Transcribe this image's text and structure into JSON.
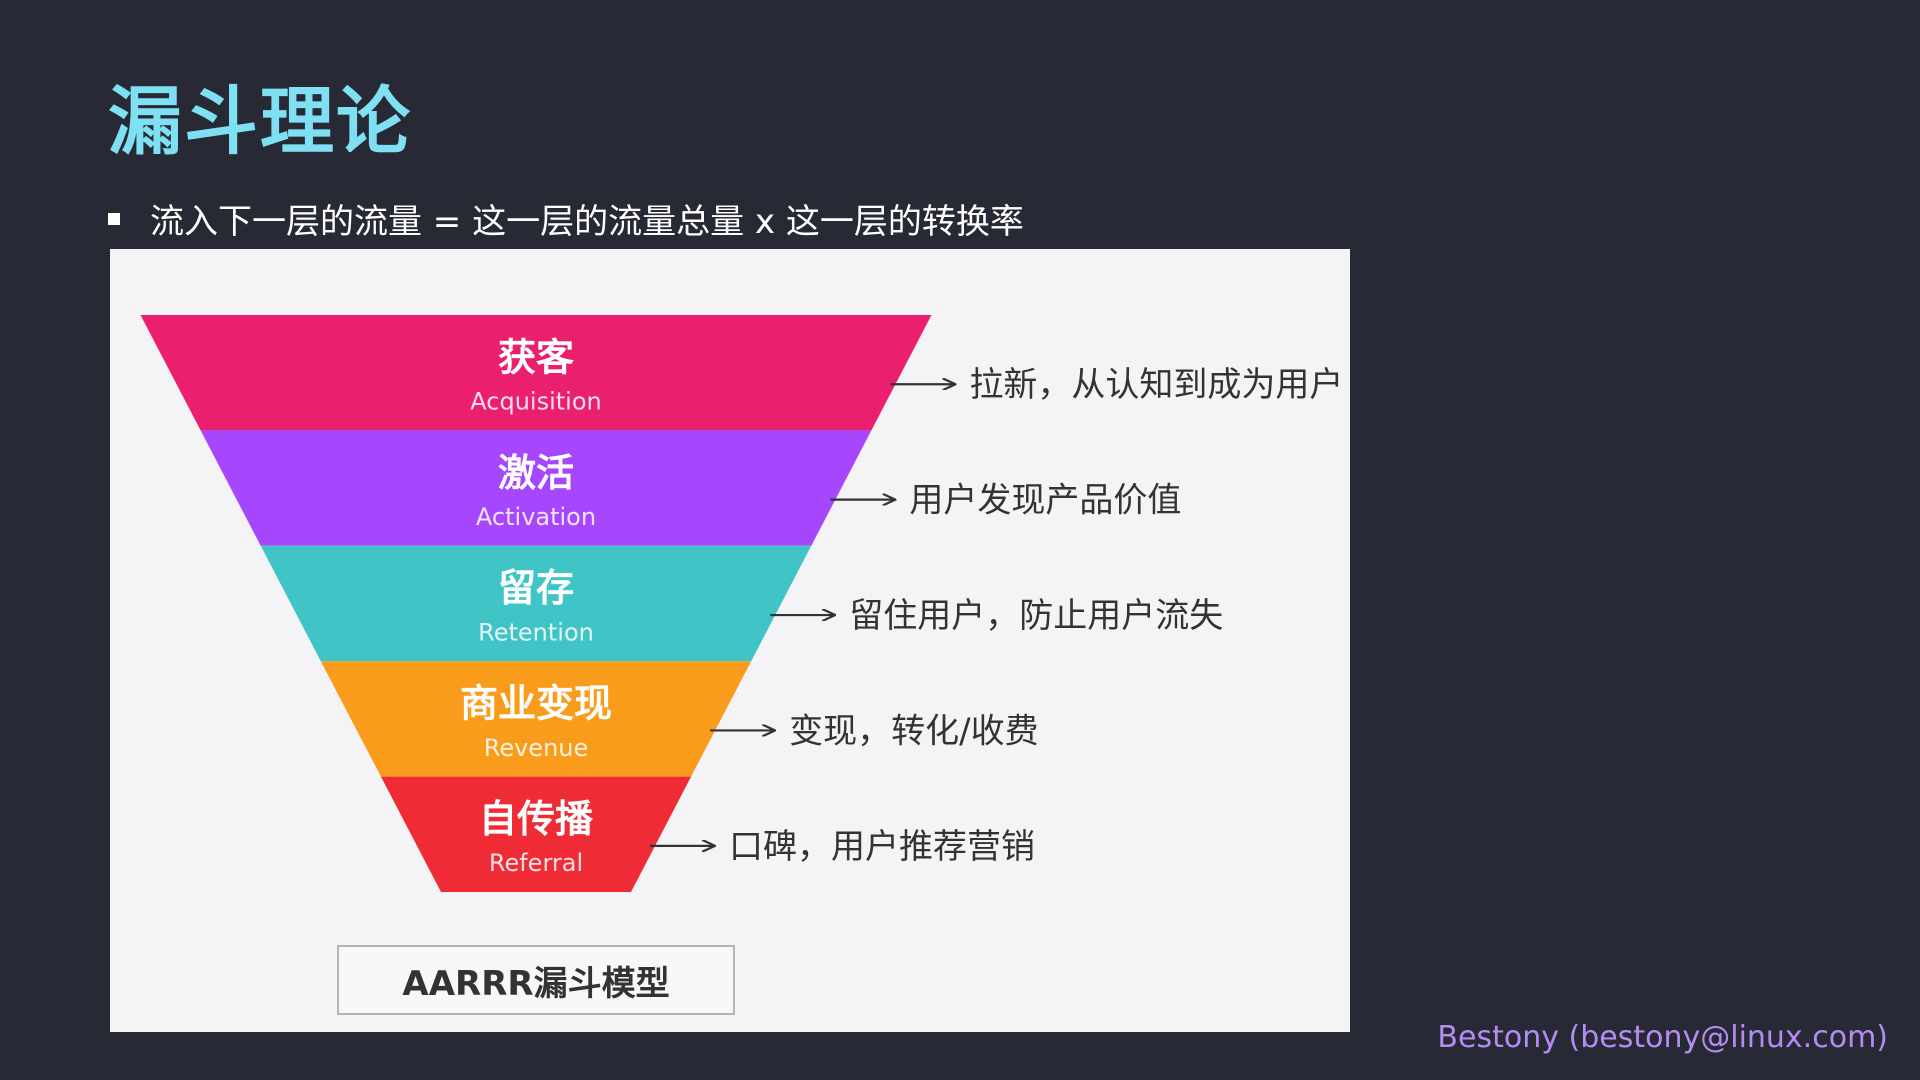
{
  "slide": {
    "title": "漏斗理论",
    "bullet": "流入下一层的流量 = 这一层的流量总量 x 这一层的转换率",
    "footer": "Bestony (bestony@linux.com)"
  },
  "funnel": {
    "caption": "AARRR漏斗模型",
    "layers": [
      {
        "name": "获客",
        "english": "Acquisition",
        "description": "拉新，从认知到成为用户",
        "color": "#ea206f"
      },
      {
        "name": "激活",
        "english": "Activation",
        "description": "用户发现产品价值",
        "color": "#a747fd"
      },
      {
        "name": "留存",
        "english": "Retention",
        "description": "留住用户，防止用户流失",
        "color": "#40c4c6"
      },
      {
        "name": "商业变现",
        "english": "Revenue",
        "description": "变现，转化/收费",
        "color": "#f99c1c"
      },
      {
        "name": "自传播",
        "english": "Referral",
        "description": "口碑，用户推荐营销",
        "color": "#ef2c35"
      }
    ]
  }
}
